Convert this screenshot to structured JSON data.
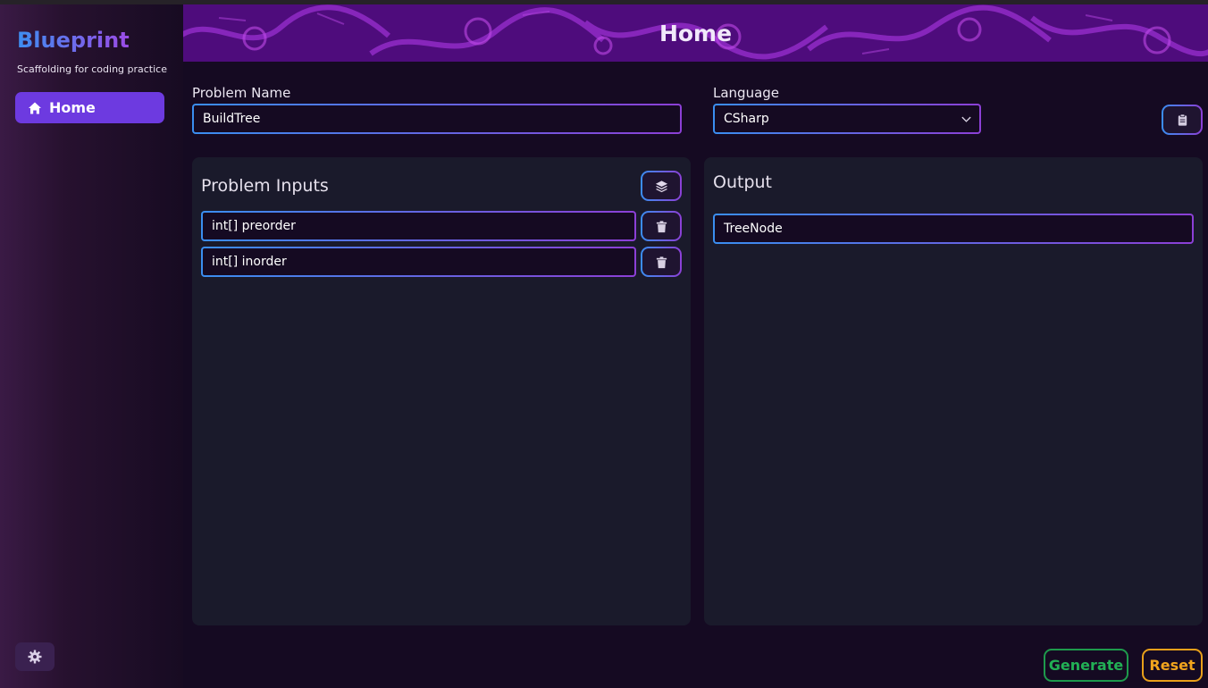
{
  "sidebar": {
    "brand": "Blueprint",
    "tagline": "Scaffolding for coding practice",
    "nav": [
      {
        "label": "Home",
        "icon": "home-icon",
        "active": true
      }
    ],
    "settings_icon": "gear-icon"
  },
  "header": {
    "title": "Home"
  },
  "form": {
    "problem_name_label": "Problem Name",
    "problem_name_value": "BuildTree",
    "language_label": "Language",
    "language_value": "CSharp",
    "copy_icon": "clipboard-icon"
  },
  "inputs_panel": {
    "title": "Problem Inputs",
    "add_icon": "layers-icon",
    "inputs": [
      {
        "value": "int[] preorder",
        "delete_icon": "trash-icon"
      },
      {
        "value": "int[] inorder",
        "delete_icon": "trash-icon"
      }
    ]
  },
  "output_panel": {
    "title": "Output",
    "value": "TreeNode"
  },
  "actions": {
    "generate_label": "Generate",
    "reset_label": "Reset"
  },
  "colors": {
    "accent": "#6d3ae0",
    "generate": "#22b055",
    "reset": "#f2a51d",
    "banner": "#5a0f8a"
  }
}
